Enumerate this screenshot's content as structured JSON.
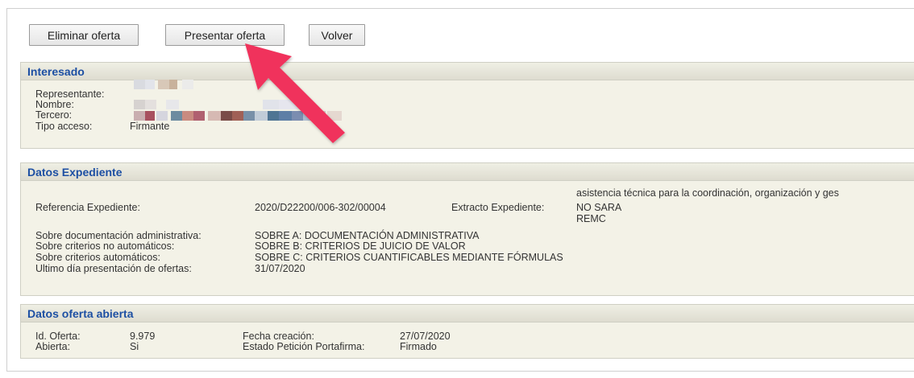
{
  "toolbar": {
    "delete_label": "Eliminar oferta",
    "submit_label": "Presentar oferta",
    "back_label": "Volver"
  },
  "interesado": {
    "title": "Interesado",
    "representante_label": "Representante:",
    "nombre_label": "Nombre:",
    "tercero_label": "Tercero:",
    "tipo_acceso_label": "Tipo acceso:",
    "tipo_acceso_value": "Firmante"
  },
  "expediente": {
    "title": "Datos Expediente",
    "referencia_label": "Referencia Expediente:",
    "referencia_value": "2020/D22200/006-302/00004",
    "extracto_label": "Extracto Expediente:",
    "extracto_line1": "asistencia técnica para la coordinación, organización y ges",
    "extracto_line2": "NO SARA",
    "extracto_line3": "REMC",
    "sobre_admin_label": "Sobre documentación administrativa:",
    "sobre_admin_value": "SOBRE A: DOCUMENTACIÓN ADMINISTRATIVA",
    "sobre_no_auto_label": "Sobre criterios no automáticos:",
    "sobre_no_auto_value": "SOBRE B: CRITERIOS DE JUICIO DE VALOR",
    "sobre_auto_label": "Sobre criterios automáticos:",
    "sobre_auto_value": "SOBRE C: CRITERIOS CUANTIFICABLES MEDIANTE FÓRMULAS",
    "ultimo_dia_label": "Ultimo día presentación de ofertas:",
    "ultimo_dia_value": "31/07/2020"
  },
  "oferta": {
    "title": "Datos oferta abierta",
    "id_label": "Id. Oferta:",
    "id_value": "9.979",
    "abierta_label": "Abierta:",
    "abierta_value": "Si",
    "fecha_label": "Fecha creación:",
    "fecha_value": "27/07/2020",
    "estado_label": "Estado Petición Portafirma:",
    "estado_value": "Firmado"
  },
  "colors": {
    "panel_bg": "#f3f2e7",
    "header_text": "#1d4fa3",
    "arrow": "#f0325c"
  }
}
